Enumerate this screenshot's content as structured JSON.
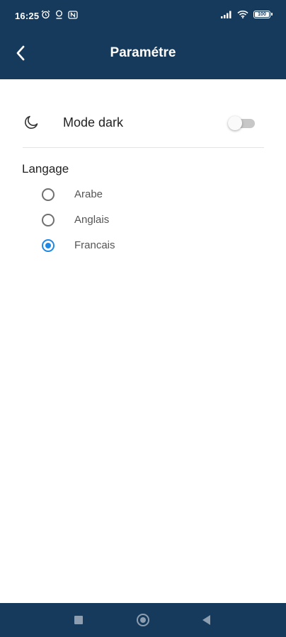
{
  "status_bar": {
    "time": "16:25",
    "battery_level": "100",
    "icons_left": [
      "alarm-icon",
      "location-icon",
      "nfc-icon"
    ],
    "icons_right": [
      "signal-icon",
      "wifi-icon",
      "battery-icon"
    ]
  },
  "app_bar": {
    "title": "Paramétre",
    "back_icon": "chevron-left-icon"
  },
  "settings": {
    "dark_mode": {
      "label": "Mode dark",
      "icon": "moon-icon",
      "enabled": false
    },
    "language": {
      "title": "Langage",
      "options": [
        {
          "label": "Arabe",
          "selected": false
        },
        {
          "label": "Anglais",
          "selected": false
        },
        {
          "label": "Francais",
          "selected": true
        }
      ]
    }
  },
  "nav_bar": {
    "buttons": [
      "recents-square-icon",
      "home-circle-icon",
      "back-triangle-icon"
    ]
  },
  "colors": {
    "primary": "#153a5b",
    "accent": "#1e88e5",
    "background": "#ffffff"
  }
}
